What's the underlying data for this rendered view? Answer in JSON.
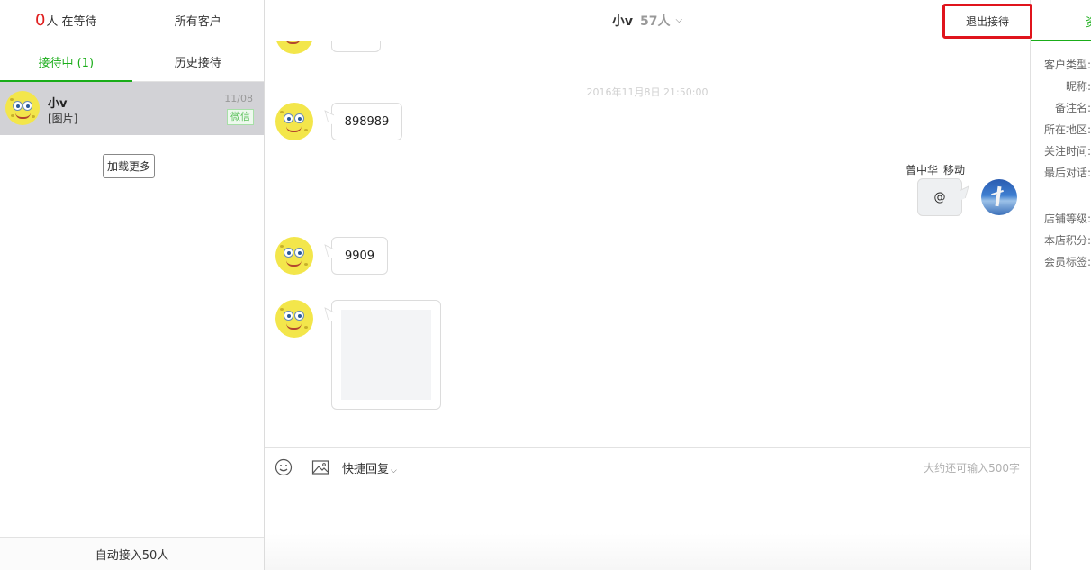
{
  "left": {
    "waiting_count": "0",
    "waiting_label": "人 在等待",
    "all_customers": "所有客户",
    "tabs": [
      {
        "label": "接待中 (1)",
        "active": true
      },
      {
        "label": "历史接待",
        "active": false
      }
    ],
    "session": {
      "name": "小v",
      "preview": "[图片]",
      "date": "11/08",
      "badge": "微信"
    },
    "load_more": "加载更多",
    "auto_accept": "自动接入50人"
  },
  "chat": {
    "name": "小v",
    "member_count": "57人",
    "exit_button": "退出接待",
    "timestamp": "2016年11月8日 21:50:00",
    "messages": [
      {
        "side": "left",
        "text": "898989"
      },
      {
        "side": "right",
        "sender": "曾中华_移动",
        "text": "@"
      },
      {
        "side": "left",
        "text": "9909"
      },
      {
        "side": "left",
        "type": "image"
      }
    ],
    "quick_reply": "快捷回复",
    "char_remaining": "大约还可输入500字"
  },
  "right": {
    "tab_label": "资",
    "info_labels": [
      "客户类型:",
      "昵称:",
      "备注名:",
      "所在地区:",
      "关注时间:",
      "最后对话:"
    ],
    "member_labels": [
      "店铺等级:",
      "本店积分:",
      "会员标签:"
    ]
  },
  "colors": {
    "accent_green": "#1aad19",
    "alert_red": "#e01e1e",
    "selected_row": "#d2d2d6"
  }
}
